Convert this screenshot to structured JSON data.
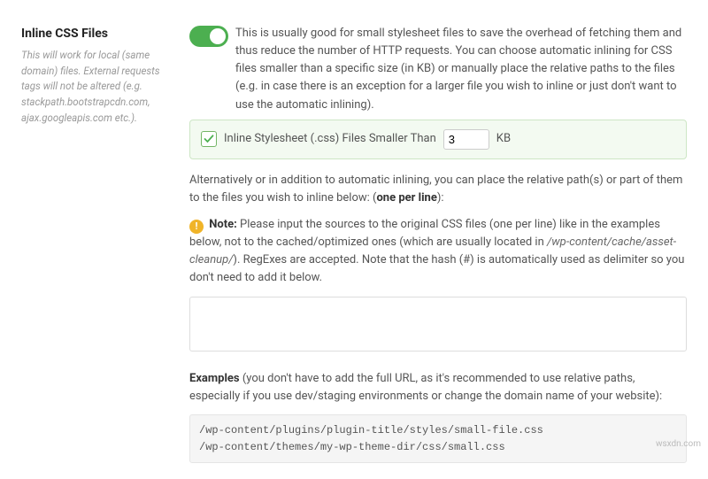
{
  "left": {
    "title": "Inline CSS Files",
    "desc": "This will work for local (same domain) files. External requests tags will not be altered (e.g. stackpath.bootstrapcdn.com, ajax.googleapis.com etc.)."
  },
  "toggle": {
    "on": true
  },
  "paragraphs": {
    "intro": "This is usually good for small stylesheet files to save the overhead of fetching them and thus reduce the number of HTTP requests. You can choose automatic inlining for CSS files smaller than a specific size (in KB) or manually place the relative paths to the files (e.g. in case there is an exception for a larger file you wish to inline or just don't want to use the automatic inlining).",
    "alt_a": "Alternatively or in addition to automatic inlining, you can place the relative path(s) or part of them to the files you wish to inline below: (",
    "alt_b": "one per line",
    "alt_c": "):",
    "note_label": "Note:",
    "note_a": " Please input the sources to the original CSS files (one per line) like in the examples below, not to the cached/optimized ones (which are usually located in ",
    "note_path": "/wp-content/cache/asset-cleanup/",
    "note_b": "). RegExes are accepted. Note that the hash (#) is automatically used as delimiter so you don't need to add it below.",
    "examples_label": "Examples",
    "examples_text": " (you don't have to add the full URL, as it's recommended to use relative paths, especially if you use dev/staging environments or change the domain name of your website):"
  },
  "greenbox": {
    "checked": true,
    "label_before": "Inline Stylesheet (.css) Files Smaller Than",
    "value": "3",
    "label_after": "KB"
  },
  "code": "/wp-content/plugins/plugin-title/styles/small-file.css\n/wp-content/themes/my-wp-theme-dir/css/small.css",
  "watermark": "wsxdn.com"
}
